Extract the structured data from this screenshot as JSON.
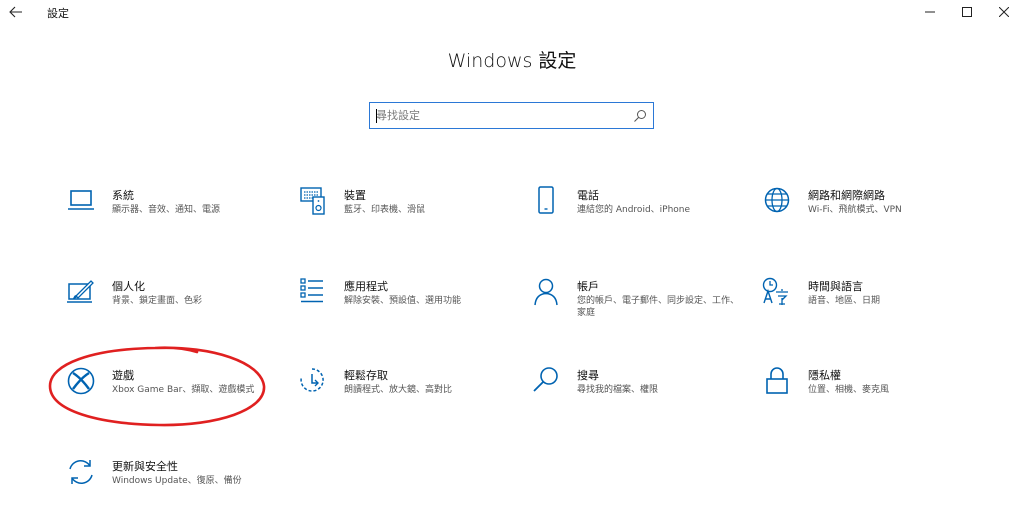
{
  "window": {
    "title": "設定",
    "back_glyph": "←",
    "minimize_glyph": "—",
    "maximize_glyph": "☐",
    "close_glyph": "✕"
  },
  "page_title": "Windows 設定",
  "search": {
    "placeholder": "尋找設定",
    "value": ""
  },
  "tiles": [
    {
      "name": "系統",
      "desc": "顯示器、音效、通知、電源",
      "icon": "laptop-icon"
    },
    {
      "name": "裝置",
      "desc": "藍牙、印表機、滑鼠",
      "icon": "devices-icon"
    },
    {
      "name": "電話",
      "desc": "連結您的 Android、iPhone",
      "icon": "phone-icon"
    },
    {
      "name": "網路和網際網路",
      "desc": "Wi-Fi、飛航模式、VPN",
      "icon": "globe-icon"
    },
    {
      "name": "個人化",
      "desc": "背景、鎖定畫面、色彩",
      "icon": "personalization-icon"
    },
    {
      "name": "應用程式",
      "desc": "解除安裝、預設值、選用功能",
      "icon": "apps-list-icon"
    },
    {
      "name": "帳戶",
      "desc": "您的帳戶、電子郵件、同步設定、工作、家庭",
      "icon": "person-icon"
    },
    {
      "name": "時間與語言",
      "desc": "語音、地區、日期",
      "icon": "time-language-icon"
    },
    {
      "name": "遊戲",
      "desc": "Xbox Game Bar、擷取、遊戲模式",
      "icon": "xbox-icon"
    },
    {
      "name": "輕鬆存取",
      "desc": "朗讀程式、放大鏡、高對比",
      "icon": "ease-of-access-icon"
    },
    {
      "name": "搜尋",
      "desc": "尋找我的檔案、權限",
      "icon": "search-magnifier-icon"
    },
    {
      "name": "隱私權",
      "desc": "位置、相機、麥克風",
      "icon": "lock-icon"
    },
    {
      "name": "更新與安全性",
      "desc": "Windows Update、復原、備份",
      "icon": "update-sync-icon"
    }
  ],
  "colors": {
    "accent": "#0063b1",
    "search_border": "#2b78d6",
    "annotation": "#e02020"
  }
}
